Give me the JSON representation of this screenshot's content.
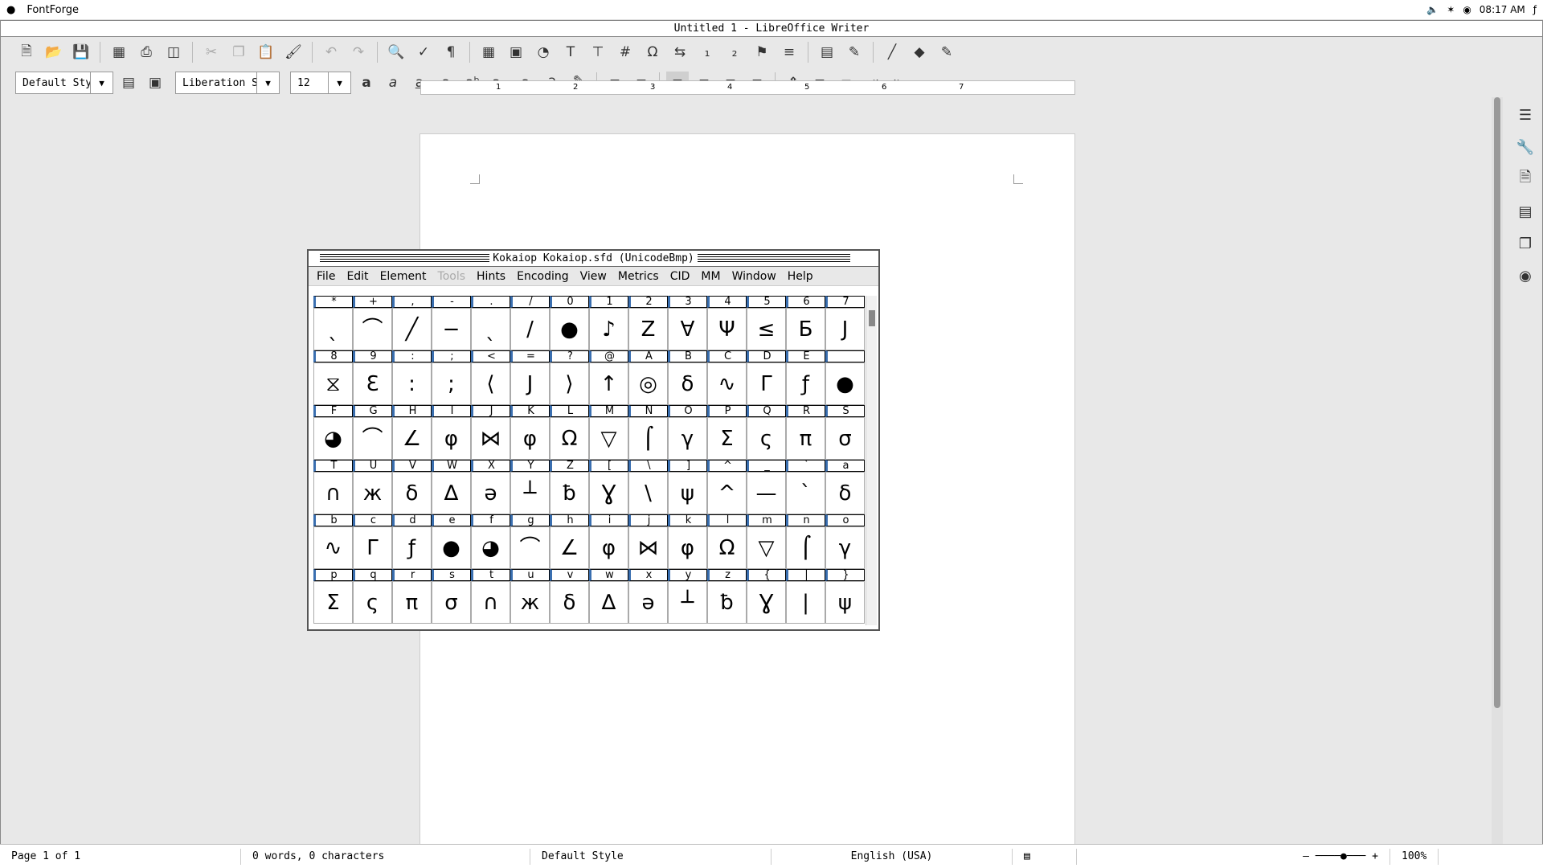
{
  "sysbar": {
    "app": "FontForge",
    "time": "08:17 AM"
  },
  "writer": {
    "title": "Untitled 1 - LibreOffice Writer",
    "paragraph_style": "Default Stylı",
    "font_name": "Liberation Sı",
    "font_size": "12"
  },
  "ruler_ticks": [
    "1",
    "2",
    "3",
    "4",
    "5",
    "6",
    "7"
  ],
  "status": {
    "page": "Page 1 of 1",
    "words": "0 words, 0 characters",
    "style": "Default Style",
    "lang": "English (USA)",
    "zoom": "100%"
  },
  "fontforge": {
    "title": "Kokaiop  Kokaiop.sfd (UnicodeBmp)",
    "menu": [
      "File",
      "Edit",
      "Element",
      "Tools",
      "Hints",
      "Encoding",
      "View",
      "Metrics",
      "CID",
      "MM",
      "Window",
      "Help"
    ],
    "rows": [
      {
        "labels": [
          "*",
          "+",
          ",",
          "-",
          ".",
          "/",
          "0",
          "1",
          "2",
          "3",
          "4",
          "5",
          "6",
          "7"
        ],
        "glyphs": [
          "ˎ",
          "⌒",
          "╱",
          "−",
          "ˎ",
          "/",
          "●",
          "♪",
          "Z",
          "Ɐ",
          "Ψ",
          "≤",
          "Б",
          "Ј"
        ]
      },
      {
        "labels": [
          "8",
          "9",
          ":",
          ";",
          "<",
          "=",
          "?",
          "@",
          "A",
          "B",
          "C",
          "D",
          "E"
        ],
        "glyphs": [
          "⧖",
          "Ԑ",
          ":",
          ";",
          "⟨",
          "Ј",
          "⟩",
          "↑",
          "◎",
          "δ",
          "∿",
          "Γ",
          "ƒ",
          "●"
        ]
      },
      {
        "labels": [
          "F",
          "G",
          "H",
          "I",
          "J",
          "K",
          "L",
          "M",
          "N",
          "O",
          "P",
          "Q",
          "R",
          "S"
        ],
        "glyphs": [
          "◕",
          "⌒",
          "∠",
          "φ",
          "⋈",
          "φ",
          "Ω",
          "▽",
          "⌠",
          "γ",
          "Σ",
          "ς",
          "π",
          "σ"
        ]
      },
      {
        "labels": [
          "T",
          "U",
          "V",
          "W",
          "X",
          "Y",
          "Z",
          "[",
          "\\",
          "]",
          "^",
          "_",
          "`",
          "a"
        ],
        "glyphs": [
          "∩",
          "ж",
          "δ",
          "∆",
          "ə",
          "┴",
          "ƀ",
          "Ɣ",
          "\\",
          "ψ",
          "^",
          "—",
          "`",
          "δ"
        ]
      },
      {
        "labels": [
          "b",
          "c",
          "d",
          "e",
          "f",
          "g",
          "h",
          "i",
          "j",
          "k",
          "l",
          "m",
          "n",
          "o"
        ],
        "glyphs": [
          "∿",
          "Γ",
          "ƒ",
          "●",
          "◕",
          "⌒",
          "∠",
          "φ",
          "⋈",
          "φ",
          "Ω",
          "▽",
          "⌠",
          "γ"
        ]
      },
      {
        "labels": [
          "p",
          "q",
          "r",
          "s",
          "t",
          "u",
          "v",
          "w",
          "x",
          "y",
          "z",
          "{",
          "|",
          "}"
        ],
        "glyphs": [
          "Σ",
          "ς",
          "π",
          "σ",
          "∩",
          "ж",
          "δ",
          "∆",
          "ə",
          "┴",
          "ƀ",
          "Ɣ",
          "|",
          "ψ"
        ]
      }
    ]
  }
}
